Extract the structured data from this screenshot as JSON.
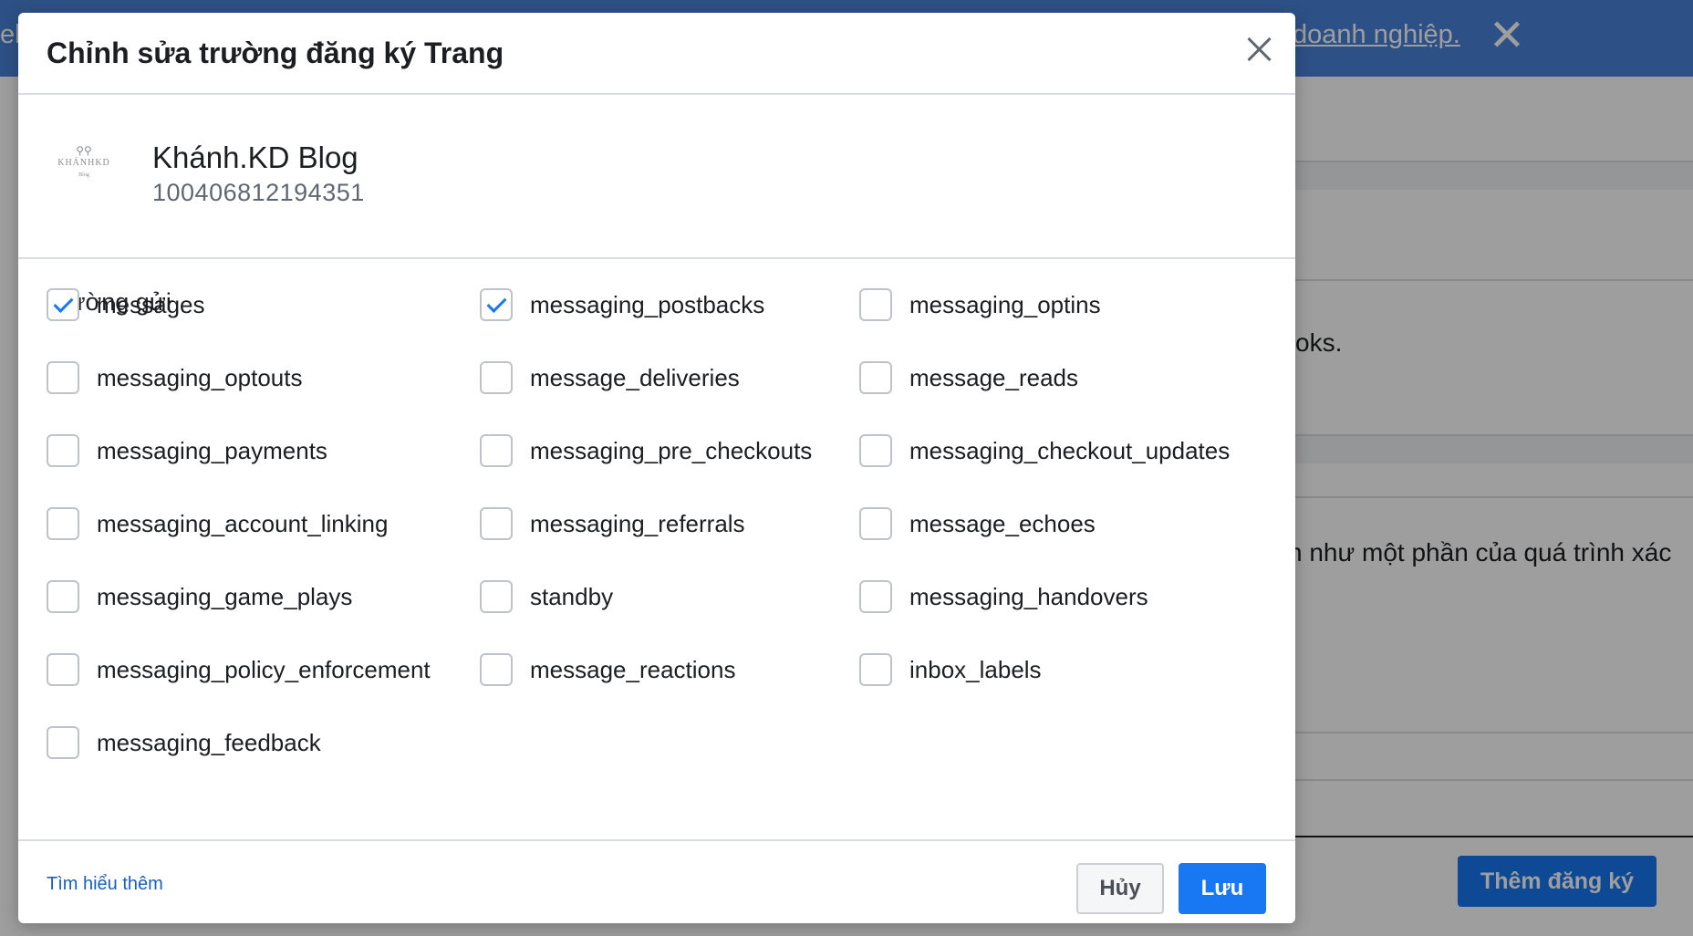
{
  "background": {
    "banner_left_text": "el",
    "banner_link_text": "doanh nghiệp.",
    "banner_close_icon": "close-icon",
    "text_fragment_1": "oks.",
    "text_fragment_2": "n như một phần của quá trình xác",
    "add_subscription_label": "Thêm đăng ký"
  },
  "modal": {
    "title": "Chỉnh sửa trường đăng ký Trang",
    "close_icon": "close-icon",
    "page": {
      "name": "Khánh.KD Blog",
      "id": "100406812194351",
      "avatar_icon": "bicycle-icon",
      "avatar_text": "KHÁNHKD",
      "avatar_subtext": "Blog"
    },
    "section_label": "Trường gửi",
    "fields": [
      {
        "label": "messages",
        "checked": true
      },
      {
        "label": "messaging_postbacks",
        "checked": true
      },
      {
        "label": "messaging_optins",
        "checked": false
      },
      {
        "label": "messaging_optouts",
        "checked": false
      },
      {
        "label": "message_deliveries",
        "checked": false
      },
      {
        "label": "message_reads",
        "checked": false
      },
      {
        "label": "messaging_payments",
        "checked": false
      },
      {
        "label": "messaging_pre_checkouts",
        "checked": false
      },
      {
        "label": "messaging_checkout_updates",
        "checked": false
      },
      {
        "label": "messaging_account_linking",
        "checked": false
      },
      {
        "label": "messaging_referrals",
        "checked": false
      },
      {
        "label": "message_echoes",
        "checked": false
      },
      {
        "label": "messaging_game_plays",
        "checked": false
      },
      {
        "label": "standby",
        "checked": false
      },
      {
        "label": "messaging_handovers",
        "checked": false
      },
      {
        "label": "messaging_policy_enforcement",
        "checked": false
      },
      {
        "label": "message_reactions",
        "checked": false
      },
      {
        "label": "inbox_labels",
        "checked": false
      },
      {
        "label": "messaging_feedback",
        "checked": false
      }
    ],
    "footer": {
      "learn_more": "Tìm hiểu thêm",
      "cancel_label": "Hủy",
      "save_label": "Lưu"
    }
  }
}
